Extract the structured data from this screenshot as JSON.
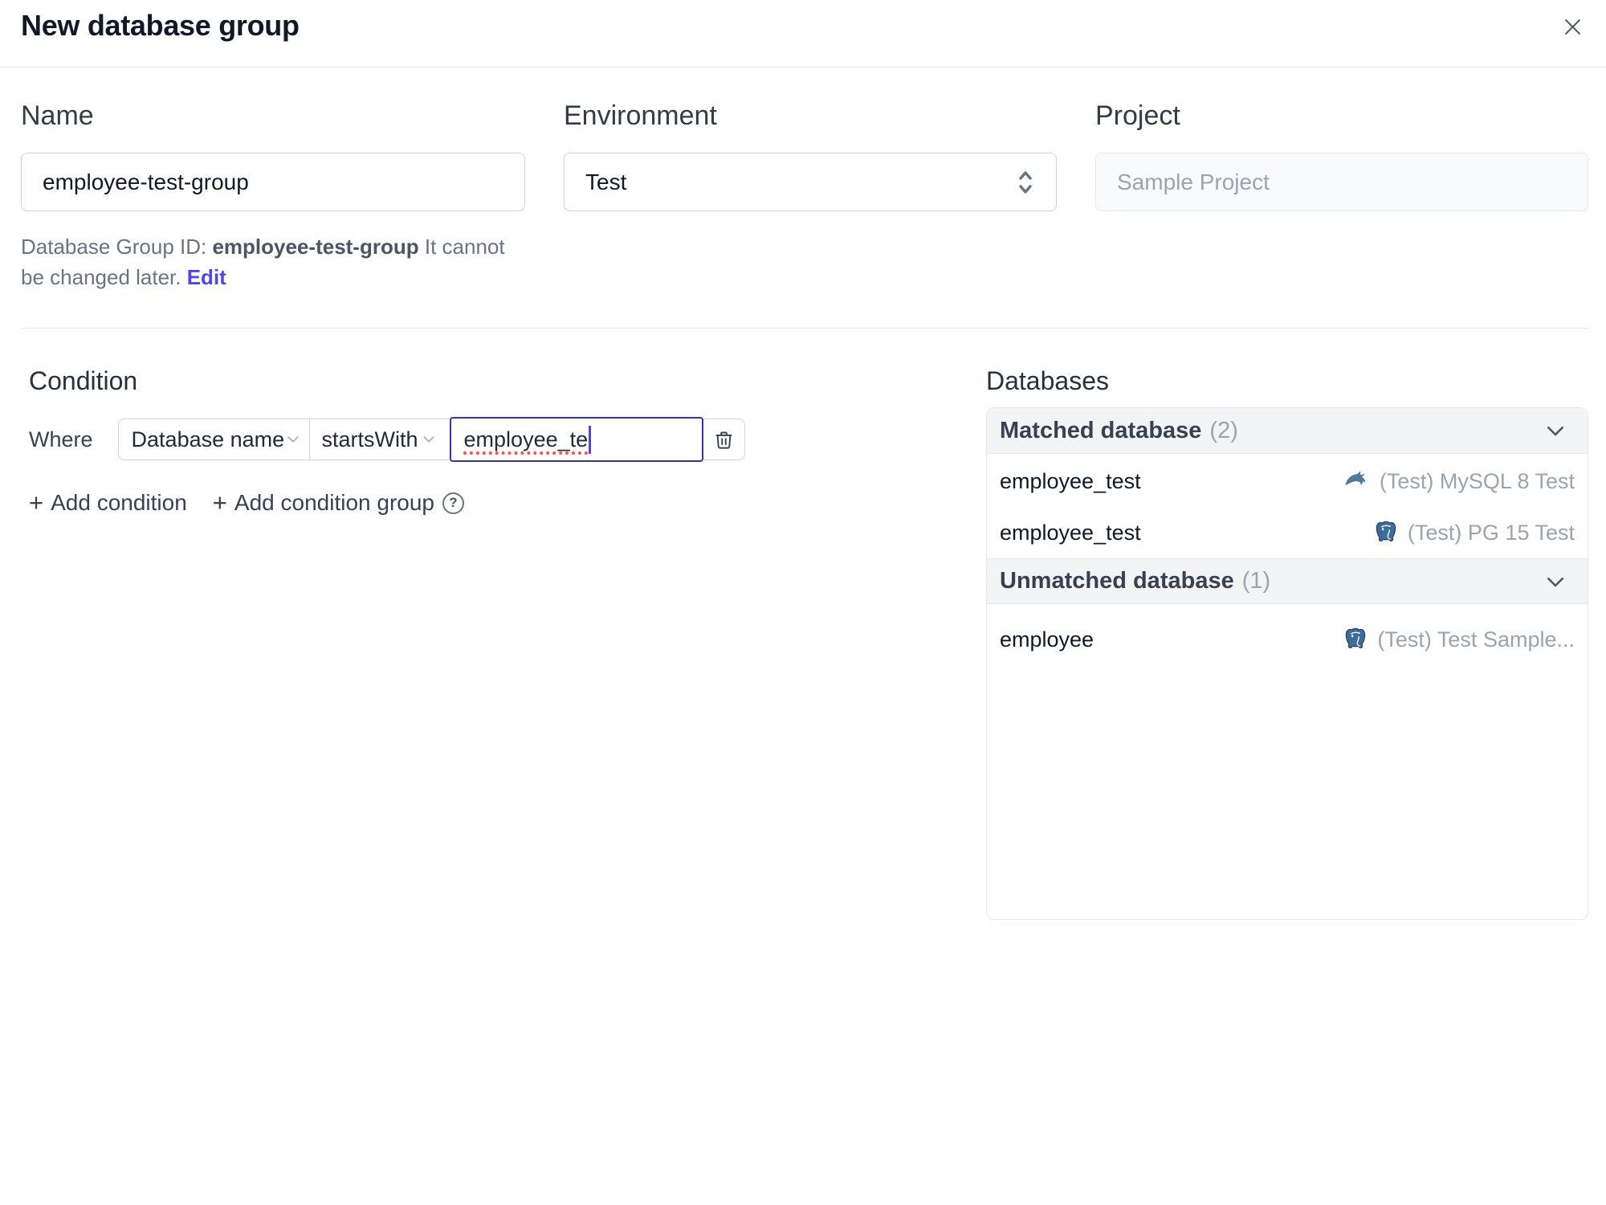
{
  "header": {
    "title": "New database group"
  },
  "form": {
    "name": {
      "label": "Name",
      "value": "employee-test-group"
    },
    "environment": {
      "label": "Environment",
      "value": "Test"
    },
    "project": {
      "label": "Project",
      "value": "Sample Project"
    },
    "group_id_note": {
      "prefix": "Database Group ID: ",
      "id": "employee-test-group",
      "suffix": " It cannot be changed later. ",
      "edit_link": "Edit"
    }
  },
  "condition": {
    "heading": "Condition",
    "where_label": "Where",
    "field_select": "Database name",
    "operator_select": "startsWith",
    "value_input": "employee_te",
    "add_condition": {
      "plus": "+",
      "label": "Add condition"
    },
    "add_condition_group": {
      "plus": "+",
      "label": "Add condition group",
      "help": "?"
    }
  },
  "databases": {
    "heading": "Databases",
    "sections": [
      {
        "title": "Matched database",
        "count": "(2)",
        "rows": [
          {
            "name": "employee_test",
            "icon": "mysql-dolphin-icon",
            "instance": "(Test) MySQL 8 Test"
          },
          {
            "name": "employee_test",
            "icon": "postgresql-elephant-icon",
            "instance": "(Test) PG 15 Test"
          }
        ]
      },
      {
        "title": "Unmatched database",
        "count": "(1)",
        "rows": [
          {
            "name": "employee",
            "icon": "postgresql-elephant-icon",
            "instance": "(Test) Test Sample..."
          }
        ]
      }
    ]
  },
  "colors": {
    "accent": "#4f46e5",
    "focus_border": "#3a3494",
    "muted_text": "#9ca3af"
  }
}
